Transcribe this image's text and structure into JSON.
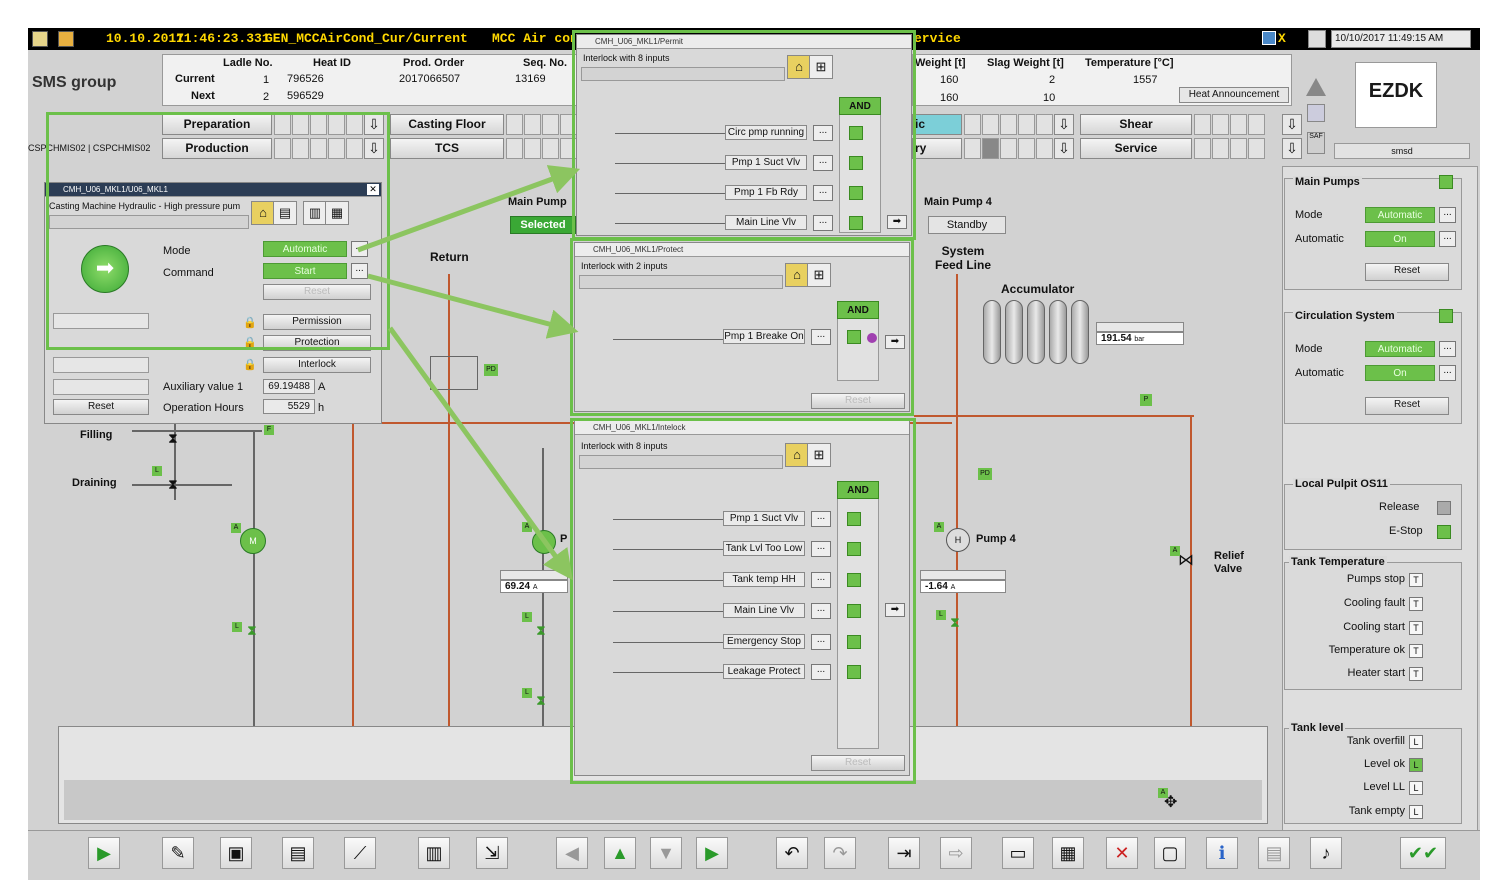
{
  "topbar": {
    "date": "10.10.2017",
    "time": "11:46:23.331",
    "message": "GEN_MCCAirCond_Cur/Current",
    "message2": "MCC Air cond",
    "service_frag": "ervice",
    "clock": "10/10/2017 11:49:15 AM"
  },
  "logo": {
    "brand": "SMS group",
    "right_logo": "EZDK"
  },
  "workstation": {
    "label": "CSPCHMIS02 | CSPCHMIS02"
  },
  "heat_table": {
    "headers": [
      "Ladle No.",
      "Heat ID",
      "Prod. Order",
      "Seq. No."
    ],
    "rows": [
      {
        "label": "Current",
        "ladle": "1",
        "heat_id": "796526",
        "prod_order": "2017066507",
        "seq": "13169"
      },
      {
        "label": "Next",
        "ladle": "2",
        "heat_id": "596529",
        "prod_order": "",
        "seq": ""
      }
    ]
  },
  "weight_table": {
    "headers": [
      "Weight [t]",
      "Slag Weight [t]",
      "Temperature [°C]"
    ],
    "rows": [
      {
        "weight": "160",
        "slag": "2",
        "temp": "1557"
      },
      {
        "weight": "160",
        "slag": "10",
        "temp": ""
      }
    ],
    "announcement": "Heat Announcement"
  },
  "nav": {
    "preparation": "Preparation",
    "casting_floor": "Casting Floor",
    "production": "Production",
    "tcs": "TCS",
    "shear": "Shear",
    "service": "Service",
    "right_label": "smsd",
    "ic_frag": "ic",
    "ry_frag": "ry"
  },
  "hydraulic_window": {
    "title": "CMH_U06_MKL1/U06_MKL1",
    "subtitle": "Casting Machine Hydraulic - High pressure pum",
    "mode_label": "Mode",
    "mode_value": "Automatic",
    "command_label": "Command",
    "command_value": "Start",
    "reset_label": "Reset",
    "permission": "Permission",
    "protection": "Protection",
    "interlock": "Interlock",
    "aux_label": "Auxiliary value 1",
    "aux_value": "69.19488",
    "aux_unit": "A",
    "hours_label": "Operation Hours",
    "hours_value": "5529",
    "hours_unit": "h",
    "reset_button": "Reset"
  },
  "permit_window": {
    "title": "CMH_U06_MKL1/Permit",
    "subtitle": "Interlock with 8 inputs",
    "and": "AND",
    "inputs": [
      "Circ pmp running",
      "Pmp 1 Suct Vlv",
      "Pmp 1 Fb Rdy",
      "Main Line Vlv"
    ]
  },
  "protect_window": {
    "title": "CMH_U06_MKL1/Protect",
    "subtitle": "Interlock with 2 inputs",
    "and": "AND",
    "inputs": [
      "Pmp 1 Breake On"
    ],
    "reset": "Reset"
  },
  "intelock_window": {
    "title": "CMH_U06_MKL1/Intelock",
    "subtitle": "Interlock with 8 inputs",
    "and": "AND",
    "inputs": [
      "Pmp 1 Suct Vlv",
      "Tank Lvl Too Low",
      "Tank temp HH",
      "Main Line Vlv",
      "Emergency Stop",
      "Leakage Protect"
    ],
    "reset": "Reset"
  },
  "process": {
    "main_pump_label": "Main Pump",
    "selected": "Selected",
    "main_pump4": "Main Pump 4",
    "standby": "Standby",
    "return_label": "Return",
    "system_feed": "System Feed Line",
    "accumulator": "Accumulator",
    "acc_value": "191.54",
    "acc_unit": "bar",
    "filling": "Filling",
    "draining": "Draining",
    "pump4": "Pump 4",
    "pump_p": "P",
    "relief": "Relief Valve",
    "val1": "69.24",
    "val1_unit": "A",
    "val2": "-1.64",
    "val2_unit": "A",
    "tags": {
      "pd": "PD",
      "a": "A",
      "l": "L",
      "f": "F",
      "p": "P",
      "m": "M",
      "h": "H"
    }
  },
  "main_pumps": {
    "title": "Main Pumps",
    "mode_label": "Mode",
    "mode_value": "Automatic",
    "auto_label": "Automatic",
    "auto_value": "On",
    "reset": "Reset"
  },
  "circulation": {
    "title": "Circulation System",
    "mode_label": "Mode",
    "mode_value": "Automatic",
    "auto_label": "Automatic",
    "auto_value": "On",
    "reset": "Reset"
  },
  "local_pulpit": {
    "title": "Local Pulpit OS11",
    "release": "Release",
    "estop": "E-Stop"
  },
  "tank_temp": {
    "title": "Tank Temperature",
    "items": [
      "Pumps stop",
      "Cooling fault",
      "Cooling start",
      "Temperature ok",
      "Heater start"
    ],
    "marker": "T"
  },
  "tank_level": {
    "title": "Tank level",
    "items": [
      "Tank overfill",
      "Level ok",
      "Level LL",
      "Tank empty"
    ],
    "marker": "L"
  },
  "colors": {
    "accent_green": "#6cc04a",
    "pipe": "#c0582e",
    "alarm_yellow": "#ffd800"
  }
}
